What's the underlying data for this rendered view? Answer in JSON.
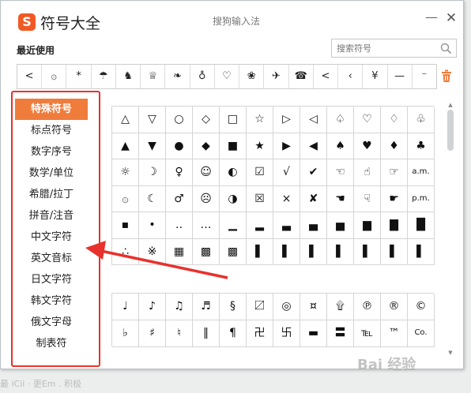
{
  "window": {
    "logo_char": "S",
    "title": "符号大全",
    "subtitle": "搜狗输入法",
    "minimize": "—",
    "close": "✕"
  },
  "recent": {
    "label": "最近使用",
    "search_placeholder": "搜索符号",
    "items": [
      "<",
      "۞",
      "*",
      "☂",
      "♞",
      "♕",
      "❧",
      "♁",
      "♡",
      "❀",
      "✈",
      "☎",
      "<",
      "‹",
      "¥",
      "—",
      "⁻"
    ]
  },
  "sidebar": {
    "items": [
      "特殊符号",
      "标点符号",
      "数字序号",
      "数学/单位",
      "希腊/拉丁",
      "拼音/注音",
      "中文字符",
      "英文音标",
      "日文字符",
      "韩文字符",
      "俄文字母",
      "制表符"
    ],
    "active_index": 0
  },
  "symbols_block1": [
    [
      "△",
      "▽",
      "○",
      "◇",
      "□",
      "☆",
      "▷",
      "◁",
      "♤",
      "♡",
      "♢",
      "♧"
    ],
    [
      "▲",
      "▼",
      "●",
      "◆",
      "■",
      "★",
      "▶",
      "◀",
      "♠",
      "♥",
      "♦",
      "♣"
    ],
    [
      "☼",
      "☽",
      "♀",
      "☺",
      "◐",
      "☑",
      "√",
      "✔",
      "☜",
      "☝",
      "☞",
      "a.m."
    ],
    [
      "۞",
      "☾",
      "♂",
      "☹",
      "◑",
      "☒",
      "×",
      "✘",
      "☚",
      "☟",
      "☛",
      "p.m."
    ],
    [
      "▪",
      "•",
      "‥",
      "…",
      "▁",
      "▂",
      "▃",
      "▄",
      "▅",
      "▆",
      "▇",
      "█"
    ],
    [
      "∴",
      "※",
      "▦",
      "▩",
      "▩",
      "▌",
      "▌",
      "▌",
      "▌",
      "▌",
      "▌",
      "▌"
    ]
  ],
  "symbols_block2": [
    [
      "♩",
      "♪",
      "♫",
      "♬",
      "§",
      "〼",
      "◎",
      "¤",
      "۩",
      "℗",
      "®",
      "©"
    ],
    [
      "♭",
      "♯",
      "♮",
      "‖",
      "¶",
      "卍",
      "卐",
      "▬",
      "〓",
      "℡",
      "™",
      "Co."
    ]
  ],
  "watermark": "Bai 经验",
  "bottom_text": "最 iCii · 更Em . 积极",
  "colors": {
    "accent": "#f07c3c",
    "highlight_border": "#e8312c",
    "logo": "#f05a24"
  }
}
